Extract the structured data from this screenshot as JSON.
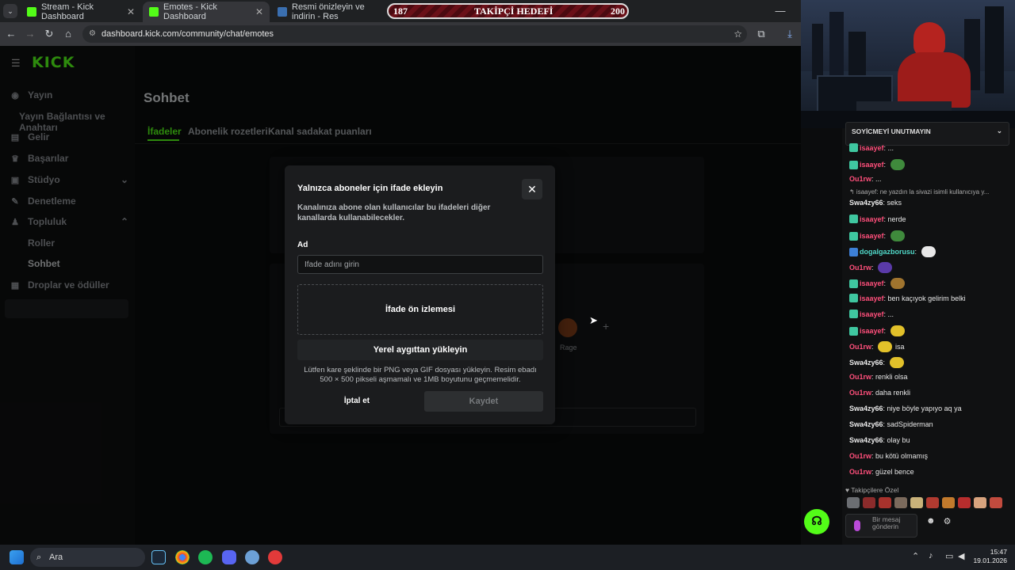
{
  "browser": {
    "tabs": [
      {
        "label": "Stream - Kick Dashboard",
        "active": false
      },
      {
        "label": "Emotes - Kick Dashboard",
        "active": true
      },
      {
        "label": "Resmi önizleyin ve indirin - Res",
        "active": false
      }
    ],
    "url": "dashboard.kick.com/community/chat/emotes"
  },
  "follower_goal": {
    "current": "187",
    "label": "TAKİPÇİ HEDEFİ",
    "target": "200"
  },
  "app": {
    "logo": "KICK"
  },
  "sidebar": {
    "items": [
      {
        "label": "Yayın",
        "icon": "broadcast-icon"
      },
      {
        "label": "Yayın Bağlantısı ve Anahtarı",
        "icon": ""
      },
      {
        "label": "Gelir",
        "icon": "revenue-icon"
      },
      {
        "label": "Başarılar",
        "icon": "trophy-icon"
      },
      {
        "label": "Stüdyo",
        "icon": "studio-icon"
      },
      {
        "label": "Denetleme",
        "icon": "moderation-icon"
      },
      {
        "label": "Topluluk",
        "icon": "community-icon"
      },
      {
        "label": "Roller",
        "icon": ""
      },
      {
        "label": "Sohbet",
        "icon": ""
      },
      {
        "label": "Droplar ve ödüller",
        "icon": "drops-icon"
      }
    ]
  },
  "main": {
    "title": "Sohbet",
    "tabs": [
      "İfadeler",
      "Abonelik rozetleri",
      "Kanal sadakat puanları"
    ],
    "bg_emote_label": "Rage"
  },
  "modal": {
    "title": "Yalnızca aboneler için ifade ekleyin",
    "description": "Kanalınıza abone olan kullanıcılar bu ifadeleri diğer kanallarda kullanabilecekler.",
    "name_label": "Ad",
    "name_placeholder": "İfade adını girin",
    "preview_label": "İfade ön izlemesi",
    "upload_label": "Yerel aygıttan yükleyin",
    "hint": "Lütfen kare şeklinde bir PNG veya GIF dosyası yükleyin. Resim ebadı 500 × 500 pikseli aşmamalı ve 1MB boyutunu geçmemelidir.",
    "cancel_label": "İptal et",
    "save_label": "Kaydet"
  },
  "chat": {
    "pinned": "SOYİCMEYİ UNUTMAYIN",
    "reply": "↰ isaayef: ne yazdın la sivazi isimli kullanıcıya y...",
    "messages": [
      {
        "user": "isaayef",
        "text": "...",
        "color": "red",
        "badge": true
      },
      {
        "user": "isaayef",
        "text": "",
        "color": "red",
        "badge": true,
        "emote": "#3f8a3c"
      },
      {
        "user": "Ou1rw",
        "text": "...",
        "color": "red",
        "badge": false
      },
      {
        "user": "Swa4zy66",
        "text": "seks",
        "color": "white",
        "badge": false
      },
      {
        "user": "isaayef",
        "text": "nerde",
        "color": "red",
        "badge": true
      },
      {
        "user": "isaayef",
        "text": "",
        "color": "red",
        "badge": true,
        "emote": "#3f8a3c"
      },
      {
        "user": "dogalgazborusu",
        "text": "",
        "color": "cyan",
        "badge": true,
        "emote": "#e8e8e8"
      },
      {
        "user": "Ou1rw",
        "text": "",
        "color": "red",
        "badge": false,
        "emote": "#5a3aa8"
      },
      {
        "user": "isaayef",
        "text": "",
        "color": "red",
        "badge": true,
        "emote": "#a0742e"
      },
      {
        "user": "isaayef",
        "text": "ben kaçıyok gelirim belki",
        "color": "red",
        "badge": true
      },
      {
        "user": "isaayef",
        "text": "...",
        "color": "red",
        "badge": true
      },
      {
        "user": "isaayef",
        "text": "",
        "color": "red",
        "badge": true,
        "emote": "#e2c12a"
      },
      {
        "user": "Ou1rw",
        "text": "isa",
        "color": "red",
        "badge": false,
        "emote": "#e2c12a"
      },
      {
        "user": "Swa4zy66",
        "text": "",
        "color": "white",
        "badge": false,
        "emote": "#e2c12a"
      },
      {
        "user": "Ou1rw",
        "text": "renkli olsa",
        "color": "red",
        "badge": false
      },
      {
        "user": "Ou1rw",
        "text": "daha renkli",
        "color": "red",
        "badge": false
      },
      {
        "user": "Swa4zy66",
        "text": "niye böyle yapıyo aq ya",
        "color": "white",
        "badge": false
      },
      {
        "user": "Swa4zy66",
        "text": "sadSpiderman",
        "color": "white",
        "badge": false
      },
      {
        "user": "Swa4zy66",
        "text": "olay bu",
        "color": "white",
        "badge": false
      },
      {
        "user": "Ou1rw",
        "text": "bu kötü olmamış",
        "color": "red",
        "badge": false
      },
      {
        "user": "Ou1rw",
        "text": "güzel bence",
        "color": "red",
        "badge": false
      }
    ],
    "follower_label": "♥ Takipçilere Özel",
    "input_placeholder": "Bir mesaj gönderin"
  },
  "taskbar": {
    "search_label": "Ara",
    "time": "15:47",
    "date": "19.01.2026"
  },
  "colors": {
    "kick_green": "#53fc18",
    "user_red": "#ff4f7b",
    "user_cyan": "#50d8c8"
  }
}
